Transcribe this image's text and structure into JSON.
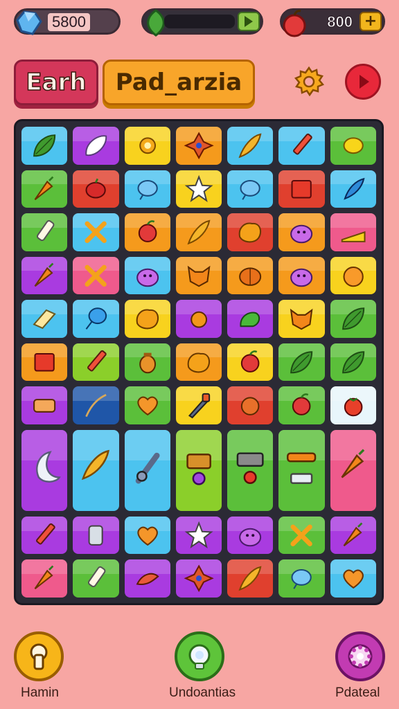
{
  "resources": {
    "gems": "5800",
    "energy_fill": 0,
    "coins": "800",
    "plus_symbol": "+"
  },
  "header": {
    "tab_left": "Earh",
    "tab_right": "Pad_arzia"
  },
  "colors": {
    "background": "#f7a6a3",
    "board": "#2b2a35",
    "tile_palette": {
      "cyan": "#4cc3ef",
      "purple": "#a93be0",
      "yellow": "#f8d21e",
      "orange": "#f59a1c",
      "green": "#5bbf3a",
      "red": "#e0402e",
      "pink": "#ef5a8c",
      "darkblue": "#1f56a8",
      "lightcyan": "#e8f6fb",
      "lime": "#8bcf2a"
    }
  },
  "board": {
    "columns": 7,
    "tiles": [
      {
        "row": 0,
        "col": 0,
        "color": "cyan",
        "icon": "leaf-icon",
        "span": [
          1,
          1
        ]
      },
      {
        "row": 0,
        "col": 1,
        "color": "purple",
        "icon": "seed-icon",
        "span": [
          1,
          1
        ]
      },
      {
        "row": 0,
        "col": 2,
        "color": "yellow",
        "icon": "sun-creature-icon",
        "span": [
          1,
          1
        ]
      },
      {
        "row": 0,
        "col": 3,
        "color": "orange",
        "icon": "star-gem-icon",
        "span": [
          1,
          1
        ]
      },
      {
        "row": 0,
        "col": 4,
        "color": "cyan",
        "icon": "feather-icon",
        "span": [
          1,
          1
        ]
      },
      {
        "row": 0,
        "col": 5,
        "color": "cyan",
        "icon": "pencil-icon",
        "span": [
          1,
          1
        ]
      },
      {
        "row": 0,
        "col": 6,
        "color": "green",
        "icon": "lemon-icon",
        "span": [
          1,
          1
        ]
      },
      {
        "row": 1,
        "col": 0,
        "color": "green",
        "icon": "carrot-icon",
        "span": [
          1,
          1
        ]
      },
      {
        "row": 1,
        "col": 1,
        "color": "red",
        "icon": "berry-icon",
        "span": [
          1,
          1
        ]
      },
      {
        "row": 1,
        "col": 2,
        "color": "cyan",
        "icon": "bubble-icon",
        "span": [
          1,
          1
        ]
      },
      {
        "row": 1,
        "col": 3,
        "color": "yellow",
        "icon": "star-icon",
        "span": [
          1,
          1
        ]
      },
      {
        "row": 1,
        "col": 4,
        "color": "cyan",
        "icon": "bubble-icon",
        "span": [
          1,
          1
        ]
      },
      {
        "row": 1,
        "col": 5,
        "color": "red",
        "icon": "box-icon",
        "span": [
          1,
          1
        ]
      },
      {
        "row": 1,
        "col": 6,
        "color": "cyan",
        "icon": "quill-icon",
        "span": [
          1,
          1
        ]
      },
      {
        "row": 2,
        "col": 0,
        "color": "green",
        "icon": "glue-icon",
        "span": [
          1,
          1
        ]
      },
      {
        "row": 2,
        "col": 1,
        "color": "cyan",
        "icon": "cross-icon",
        "span": [
          1,
          1
        ]
      },
      {
        "row": 2,
        "col": 2,
        "color": "orange",
        "icon": "apple-icon",
        "span": [
          1,
          1
        ]
      },
      {
        "row": 2,
        "col": 3,
        "color": "orange",
        "icon": "feather-icon",
        "span": [
          1,
          1
        ]
      },
      {
        "row": 2,
        "col": 4,
        "color": "red",
        "icon": "blob-icon",
        "span": [
          1,
          1
        ]
      },
      {
        "row": 2,
        "col": 5,
        "color": "orange",
        "icon": "slime-icon",
        "span": [
          1,
          1
        ]
      },
      {
        "row": 2,
        "col": 6,
        "color": "pink",
        "icon": "cheese-icon",
        "span": [
          1,
          1
        ]
      },
      {
        "row": 3,
        "col": 0,
        "color": "purple",
        "icon": "carrot-icon",
        "span": [
          1,
          1
        ]
      },
      {
        "row": 3,
        "col": 1,
        "color": "pink",
        "icon": "cross-icon",
        "span": [
          1,
          1
        ]
      },
      {
        "row": 3,
        "col": 2,
        "color": "cyan",
        "icon": "slime-icon",
        "span": [
          1,
          1
        ]
      },
      {
        "row": 3,
        "col": 3,
        "color": "orange",
        "icon": "fox-icon",
        "span": [
          1,
          1
        ]
      },
      {
        "row": 3,
        "col": 4,
        "color": "orange",
        "icon": "pumpkin-icon",
        "span": [
          1,
          1
        ]
      },
      {
        "row": 3,
        "col": 5,
        "color": "orange",
        "icon": "slime-icon",
        "span": [
          1,
          1
        ]
      },
      {
        "row": 3,
        "col": 6,
        "color": "yellow",
        "icon": "peach-icon",
        "span": [
          1,
          1
        ]
      },
      {
        "row": 4,
        "col": 0,
        "color": "cyan",
        "icon": "butter-icon",
        "span": [
          1,
          1
        ]
      },
      {
        "row": 4,
        "col": 1,
        "color": "cyan",
        "icon": "balloon-icon",
        "span": [
          1,
          1
        ]
      },
      {
        "row": 4,
        "col": 2,
        "color": "yellow",
        "icon": "blob-icon",
        "span": [
          1,
          1
        ]
      },
      {
        "row": 4,
        "col": 3,
        "color": "purple",
        "icon": "chick-icon",
        "span": [
          1,
          1
        ]
      },
      {
        "row": 4,
        "col": 4,
        "color": "purple",
        "icon": "dino-icon",
        "span": [
          1,
          1
        ]
      },
      {
        "row": 4,
        "col": 5,
        "color": "yellow",
        "icon": "fox-icon",
        "span": [
          1,
          1
        ]
      },
      {
        "row": 4,
        "col": 6,
        "color": "green",
        "icon": "leaf-icon",
        "span": [
          1,
          1
        ]
      },
      {
        "row": 5,
        "col": 0,
        "color": "orange",
        "icon": "box-icon",
        "span": [
          1,
          1
        ]
      },
      {
        "row": 5,
        "col": 1,
        "color": "lime",
        "icon": "pencil-icon",
        "span": [
          1,
          1
        ]
      },
      {
        "row": 5,
        "col": 2,
        "color": "green",
        "icon": "jar-icon",
        "span": [
          1,
          1
        ]
      },
      {
        "row": 5,
        "col": 3,
        "color": "orange",
        "icon": "blob-icon",
        "span": [
          1,
          1
        ]
      },
      {
        "row": 5,
        "col": 4,
        "color": "yellow",
        "icon": "apple-icon",
        "span": [
          1,
          1
        ]
      },
      {
        "row": 5,
        "col": 5,
        "color": "green",
        "icon": "leaf-icon",
        "span": [
          1,
          1
        ]
      },
      {
        "row": 5,
        "col": 6,
        "color": "green",
        "icon": "leaf-icon",
        "span": [
          1,
          1
        ]
      },
      {
        "row": 6,
        "col": 0,
        "color": "purple",
        "icon": "drum-icon",
        "span": [
          1,
          1
        ]
      },
      {
        "row": 6,
        "col": 1,
        "color": "darkblue",
        "icon": "branch-icon",
        "span": [
          1,
          1
        ]
      },
      {
        "row": 6,
        "col": 2,
        "color": "green",
        "icon": "heart-icon",
        "span": [
          1,
          1
        ]
      },
      {
        "row": 6,
        "col": 3,
        "color": "yellow",
        "icon": "brush-icon",
        "span": [
          1,
          1
        ]
      },
      {
        "row": 6,
        "col": 4,
        "color": "red",
        "icon": "orange-fruit-icon",
        "span": [
          1,
          1
        ]
      },
      {
        "row": 6,
        "col": 5,
        "color": "green",
        "icon": "apple-icon",
        "span": [
          1,
          1
        ]
      },
      {
        "row": 6,
        "col": 6,
        "color": "lightcyan",
        "icon": "tomato-icon",
        "span": [
          1,
          1
        ]
      },
      {
        "row": 7,
        "col": 0,
        "color": "purple",
        "icon": "moon-icon",
        "span": [
          2,
          1
        ]
      },
      {
        "row": 7,
        "col": 1,
        "color": "cyan",
        "icon": "feather-icon",
        "span": [
          2,
          1
        ]
      },
      {
        "row": 7,
        "col": 2,
        "color": "cyan",
        "icon": "wrench-icon",
        "span": [
          2,
          1
        ]
      },
      {
        "row": 7,
        "col": 3,
        "color": "lime",
        "icon": "chest-icon",
        "span": [
          2,
          1
        ]
      },
      {
        "row": 7,
        "col": 4,
        "color": "green",
        "icon": "radio-icon",
        "span": [
          2,
          1
        ]
      },
      {
        "row": 7,
        "col": 5,
        "color": "green",
        "icon": "bread-icon",
        "span": [
          2,
          1
        ]
      },
      {
        "row": 7,
        "col": 6,
        "color": "pink",
        "icon": "carrot-icon",
        "span": [
          2,
          1
        ]
      },
      {
        "row": 9,
        "col": 0,
        "color": "purple",
        "icon": "pencil-icon",
        "span": [
          1,
          1
        ]
      },
      {
        "row": 9,
        "col": 1,
        "color": "purple",
        "icon": "can-icon",
        "span": [
          1,
          1
        ]
      },
      {
        "row": 9,
        "col": 2,
        "color": "cyan",
        "icon": "heart-icon",
        "span": [
          1,
          1
        ]
      },
      {
        "row": 9,
        "col": 3,
        "color": "purple",
        "icon": "star-icon",
        "span": [
          1,
          1
        ]
      },
      {
        "row": 9,
        "col": 4,
        "color": "purple",
        "icon": "slime-icon",
        "span": [
          1,
          1
        ]
      },
      {
        "row": 9,
        "col": 5,
        "color": "green",
        "icon": "cross-icon",
        "span": [
          1,
          1
        ]
      },
      {
        "row": 9,
        "col": 6,
        "color": "purple",
        "icon": "carrot-icon",
        "span": [
          1,
          1
        ]
      },
      {
        "row": 10,
        "col": 0,
        "color": "pink",
        "icon": "carrot-icon",
        "span": [
          1,
          1
        ]
      },
      {
        "row": 10,
        "col": 1,
        "color": "green",
        "icon": "glue-icon",
        "span": [
          1,
          1
        ]
      },
      {
        "row": 10,
        "col": 2,
        "color": "purple",
        "icon": "bird-icon",
        "span": [
          1,
          1
        ]
      },
      {
        "row": 10,
        "col": 3,
        "color": "purple",
        "icon": "star-gem-icon",
        "span": [
          1,
          1
        ]
      },
      {
        "row": 10,
        "col": 4,
        "color": "red",
        "icon": "feather-icon",
        "span": [
          1,
          1
        ]
      },
      {
        "row": 10,
        "col": 5,
        "color": "green",
        "icon": "bubble-icon",
        "span": [
          1,
          1
        ]
      },
      {
        "row": 10,
        "col": 6,
        "color": "cyan",
        "icon": "heart-icon",
        "span": [
          1,
          1
        ]
      }
    ]
  },
  "bottom_nav": [
    {
      "label": "Hamin",
      "icon": "keyhole-icon"
    },
    {
      "label": "Undoantias",
      "icon": "lightbulb-icon"
    },
    {
      "label": "Pdateal",
      "icon": "gear-icon"
    }
  ]
}
